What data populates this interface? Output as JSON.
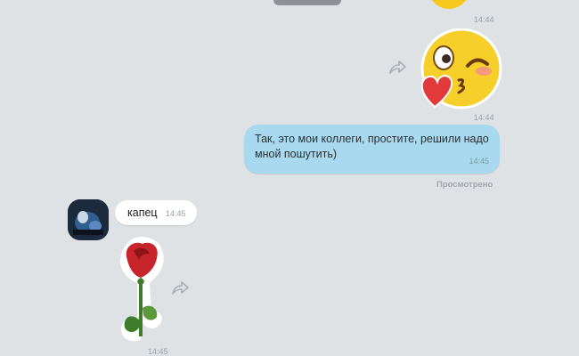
{
  "messages": [
    {
      "kind": "sticker",
      "sticker": "emoji-smile-partial",
      "time": "14:44"
    },
    {
      "kind": "sticker",
      "sticker": "emoji-kiss-wink-heart",
      "time": "14:44"
    },
    {
      "kind": "text",
      "text": "Так, это мои коллеги, простите, решили надо мной пошутить)",
      "time": "14:45",
      "status": "Просмотрено"
    },
    {
      "kind": "text",
      "text": "капец",
      "time": "14:45"
    },
    {
      "kind": "sticker",
      "sticker": "rose",
      "time": "14:45"
    }
  ],
  "icons": {
    "share": "share-arrow-icon",
    "avatar": "contact-avatar"
  },
  "colors": {
    "background": "#dfe2e5",
    "outgoing_bubble": "#a8d9ee",
    "incoming_bubble": "#ffffff",
    "rose": "#c7242c",
    "stem": "#3e7d2a"
  }
}
